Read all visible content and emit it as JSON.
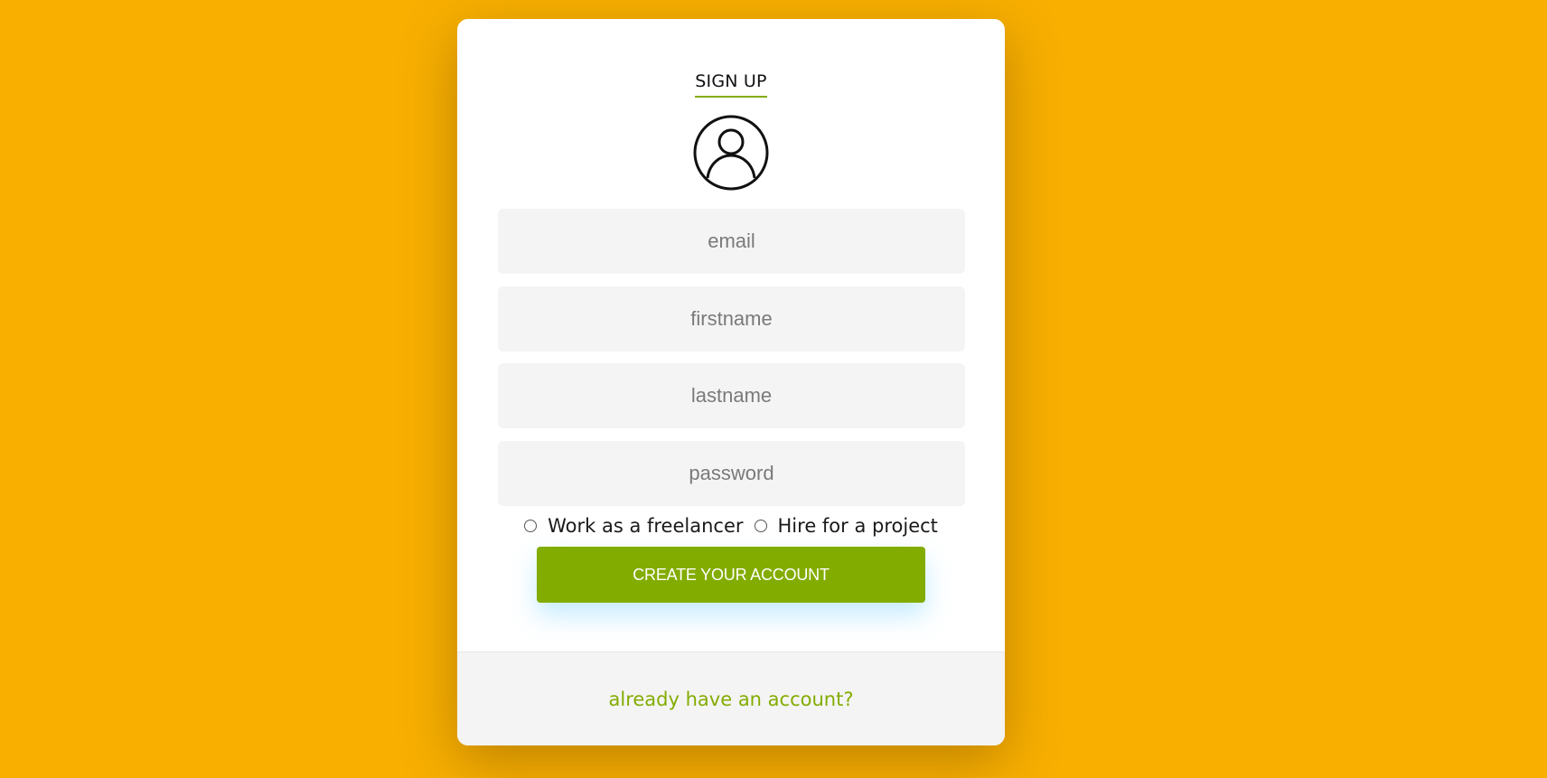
{
  "colors": {
    "background": "#F8AF00",
    "accent": "#83AC00",
    "card": "#FFFFFF",
    "field": "#F4F4F4"
  },
  "form": {
    "title": "SIGN UP",
    "avatar_icon": "user-circle-icon",
    "fields": {
      "email": {
        "placeholder": "email",
        "value": ""
      },
      "firstname": {
        "placeholder": "firstname",
        "value": ""
      },
      "lastname": {
        "placeholder": "lastname",
        "value": ""
      },
      "password": {
        "placeholder": "password",
        "value": ""
      }
    },
    "roles": [
      {
        "label": "Work as a freelancer",
        "selected": false
      },
      {
        "label": "Hire for a project",
        "selected": false
      }
    ],
    "submit_label": "CREATE YOUR ACCOUNT"
  },
  "footer": {
    "login_link": "already have an account?"
  }
}
